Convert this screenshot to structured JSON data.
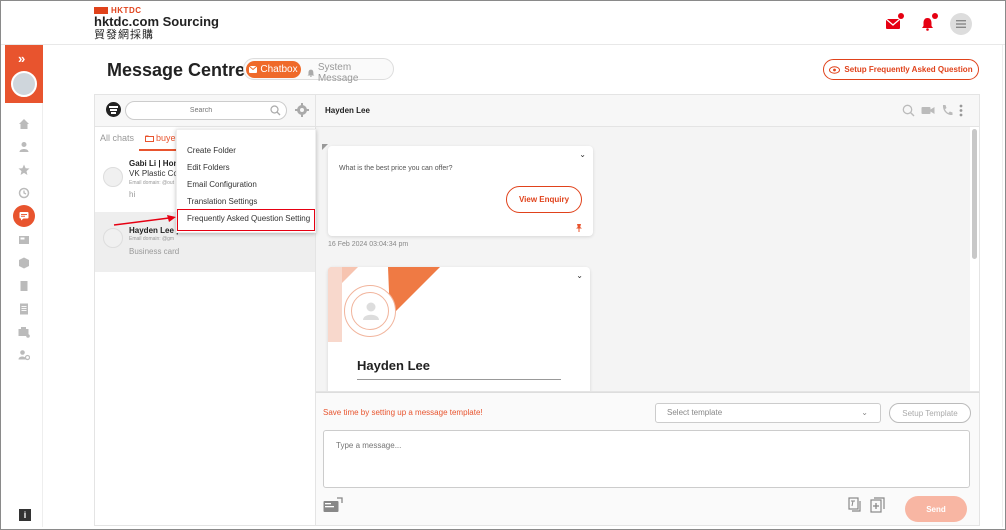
{
  "header": {
    "brand_mark": "HKTDC",
    "site_name": "hktdc.com Sourcing",
    "site_name_cn": "貿發網採購",
    "accent_color": "#e8542e"
  },
  "sidebar": {
    "items": [
      "home-icon",
      "user-icon",
      "star-icon",
      "history-icon",
      "chat-icon",
      "inbox-icon",
      "product-icon",
      "catalog-icon",
      "document-icon",
      "order-icon",
      "user-settings-icon"
    ],
    "info_label": "i"
  },
  "page": {
    "title": "Message Centre",
    "tabs": [
      {
        "label": "Chatbox",
        "active": true
      },
      {
        "label": "System Message",
        "active": false
      }
    ],
    "faq_button": "Setup Frequently Asked Question"
  },
  "chat_list": {
    "search_placeholder": "Search",
    "tabs": [
      "All chats",
      "buyer"
    ],
    "items": [
      {
        "name": "Gabi Li  |  Hon",
        "company": "VK Plastic Co",
        "email": "Email domain: @out",
        "message": "hi"
      },
      {
        "name": "Hayden Lee  |",
        "company": "",
        "email": "Email domain: @gm",
        "message": "Business card"
      }
    ]
  },
  "dropdown": {
    "items": [
      "Create Folder",
      "Edit Folders",
      "Email Configuration",
      "Translation Settings",
      "Frequently Asked Question Setting"
    ]
  },
  "conversation": {
    "contact_name": "Hayden Lee",
    "enquiry_text": "What is the best price you can offer?",
    "view_enquiry_label": "View Enquiry",
    "timestamp": "16 Feb 2024 03:04:34 pm",
    "card_name": "Hayden Lee"
  },
  "composer": {
    "template_hint": "Save time by setting up a message template!",
    "template_select_placeholder": "Select template",
    "setup_template_label": "Setup Template",
    "message_placeholder": "Type a message...",
    "send_label": "Send"
  }
}
